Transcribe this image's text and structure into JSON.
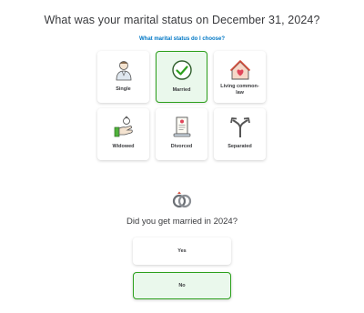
{
  "question": {
    "title": "What was your marital status on December 31, 2024?",
    "help_link": "What marital status do I choose?"
  },
  "options": [
    {
      "label": "Single",
      "icon": "single-person-icon",
      "selected": false
    },
    {
      "label": "Married",
      "icon": "checkmark-icon",
      "selected": true
    },
    {
      "label": "Living common-law",
      "icon": "house-heart-icon",
      "selected": false
    },
    {
      "label": "Widowed",
      "icon": "widowed-hand-icon",
      "selected": false
    },
    {
      "label": "Divorced",
      "icon": "divorce-certificate-icon",
      "selected": false
    },
    {
      "label": "Separated",
      "icon": "split-arrows-icon",
      "selected": false
    }
  ],
  "married_question": {
    "icon": "wedding-rings-icon",
    "title": "Did you get married in 2024?",
    "answers": [
      {
        "label": "Yes",
        "selected": false
      },
      {
        "label": "No",
        "selected": true
      }
    ]
  },
  "colors": {
    "accent_green": "#2ca01c",
    "selected_bg": "#eaf8ec",
    "link_blue": "#0077c5",
    "text": "#393a3d"
  }
}
